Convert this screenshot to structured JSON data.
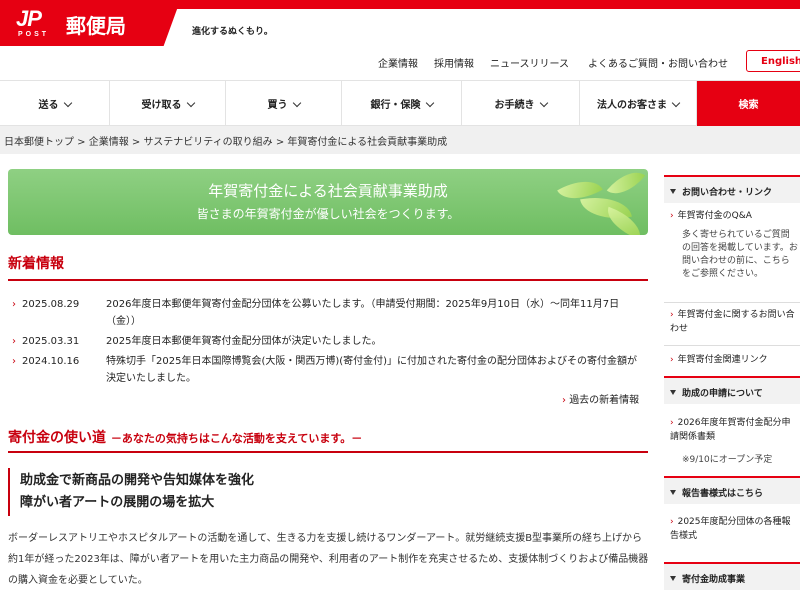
{
  "brand": {
    "jp_mark": "JP",
    "post_text": "POST",
    "name": "郵便局",
    "slogan": "進化するぬくもり。"
  },
  "utility_nav": [
    "企業情報",
    "採用情報",
    "ニュースリリース",
    "よくあるご質問・お問い合わせ"
  ],
  "lang_button": "English",
  "main_nav": [
    "送る",
    "受け取る",
    "買う",
    "銀行・保険",
    "お手続き",
    "法人のお客さま"
  ],
  "search_label": "検索",
  "breadcrumb": "日本郵便トップ > 企業情報 > サステナビリティの取り組み > 年賀寄付金による社会貢献事業助成",
  "banner": {
    "title": "年賀寄付金による社会貢献事業助成",
    "subtitle": "皆さまの年賀寄付金が優しい社会をつくります。"
  },
  "news_section": {
    "title": "新着情報",
    "items": [
      {
        "date": "2025.08.29",
        "text": "2026年度日本郵便年賀寄付金配分団体を公募いたします。（申請受付期間：2025年9月10日（水）～同年11月7日（金））"
      },
      {
        "date": "2025.03.31",
        "text": "2025年度日本郵便年賀寄付金配分団体が決定いたしました。"
      },
      {
        "date": "2024.10.16",
        "text": "特殊切手「2025年日本国際博覧会(大阪・関西万博)(寄付金付)」に付加された寄付金の配分団体およびその寄付金額が決定いたしました。"
      }
    ],
    "past_link": "過去の新着情報"
  },
  "usage_section": {
    "title": "寄付金の使い道",
    "subtitle": "－あなたの気持ちはこんな活動を支えています。－",
    "headline_1": "助成金で新商品の開発や告知媒体を強化",
    "headline_2": "障がい者アートの展開の場を拡大",
    "body": "ボーダーレスアトリエやホスピタルアートの活動を通して、生きる力を支援し続けるワンダーアート。就労継続支援B型事業所の経ち上げから約1年が経った2023年は、障がい者アートを用いた主力商品の開発や、利用者のアート制作を充実させるため、支援体制づくりおよび備品機器の購入資金を必要としていた。"
  },
  "sidebar": {
    "sections": [
      {
        "title": "お問い合わせ・リンク"
      },
      {
        "title": "助成の申請について"
      },
      {
        "title": "報告書様式はこちら"
      },
      {
        "title": "寄付金助成事業"
      }
    ],
    "qa_link": "年賀寄付金のQ&A",
    "qa_note": "多く寄せられているご質問の回答を掲載しています。お問い合わせの前に、こちらをご参照ください。",
    "contact_link": "年賀寄付金に関するお問い合わせ",
    "related_link": "年賀寄付金関連リンク",
    "apply_link": "2026年度年賀寄付金配分申請関係書類",
    "apply_note": "※9/10にオープン予定",
    "report_link": "2025年度配分団体の各種報告様式"
  },
  "colors": {
    "brand_red": "#e60012",
    "banner_green": "#7cc66e"
  }
}
